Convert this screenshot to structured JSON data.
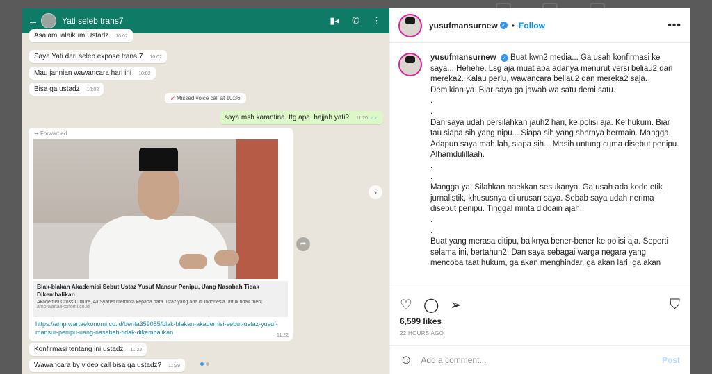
{
  "whatsapp": {
    "contact_name": "Yati seleb trans7",
    "messages": [
      {
        "text": "Asalamualaikum Ustadz",
        "time": "10:02"
      },
      {
        "text": "Saya Yati dari seleb expose trans 7",
        "time": "10:02"
      },
      {
        "text": "Mau jannian wawancara hari ini",
        "time": "10:02"
      },
      {
        "text": "Bisa ga ustadz",
        "time": "10:02"
      }
    ],
    "missed_call": "Missed voice call at 10:36",
    "outgoing": {
      "text": "saya msh karantina. ttg apa, hajjah yati?",
      "time": "11:20"
    },
    "forwarded_label": "Forwarded",
    "link_title": "Blak-blakan Akademisi Sebut Ustaz Yusuf Mansur Penipu, Uang Nasabah Tidak Dikembalikan",
    "link_desc": "Akademisi Cross Culture, Ali Syarief meminta kepada para ustaz yang ada di Indonesia untuk tidak menj...",
    "link_domain": "amp.wartaekonomi.co.id",
    "link_url": "https://amp.wartaekonomi.co.id/berita359055/blak-blakan-akademisi-sebut-ustaz-yusuf-mansur-penipu-uang-nasabah-tidak-dikembalikan",
    "fwd_time": "11:22",
    "after": [
      {
        "text": "Konfirmasi tentang ini ustadz",
        "time": "11:22"
      },
      {
        "text": "Wawancara by video call bisa ga ustadz?",
        "time": "11:39"
      }
    ]
  },
  "header": {
    "username": "yusufmansurnew",
    "follow_label": "Follow",
    "more_label": "•••"
  },
  "caption": {
    "username": "yusufmansurnew",
    "lines": [
      "Buat kwn2 media... Ga usah konfirmasi ke saya... Hehehe. Lsg aja muat apa adanya menurut versi beliau2 dan mereka2. Kalau perlu, wawancara beliau2 dan mereka2 saja. Demikian ya. Biar saya ga jawab wa satu demi satu.",
      ".",
      ".",
      "Dan saya udah persilahkan jauh2 hari, ke polisi aja. Ke hukum. Biar tau siapa sih yang nipu... Siapa sih yang sbnrnya bermain. Mangga. Adapun saya mah lah, siapa sih... Masih untung cuma disebut penipu. Alhamdulillaah.",
      ".",
      ".",
      "Mangga ya. Silahkan naekkan sesukanya. Ga usah ada kode etik jurnalistik, khususnya di urusan saya. Sebab saya udah nerima disebut penipu. Tinggal minta didoain ajah.",
      ".",
      ".",
      "Buat yang merasa ditipu, baiknya bener-bener ke polisi aja. Seperti selama ini, bertahun2. Dan saya sebagai warga negara yang mencoba taat hukum, ga akan menghindar, ga akan lari, ga akan"
    ]
  },
  "stats": {
    "likes": "6,599 likes",
    "time_ago": "22 HOURS AGO"
  },
  "comment": {
    "placeholder": "Add a comment...",
    "post_label": "Post"
  },
  "colors": {
    "whatsapp_header": "#0f7a66",
    "follow_blue": "#0095f6",
    "post_button_disabled": "#b3dbff"
  }
}
